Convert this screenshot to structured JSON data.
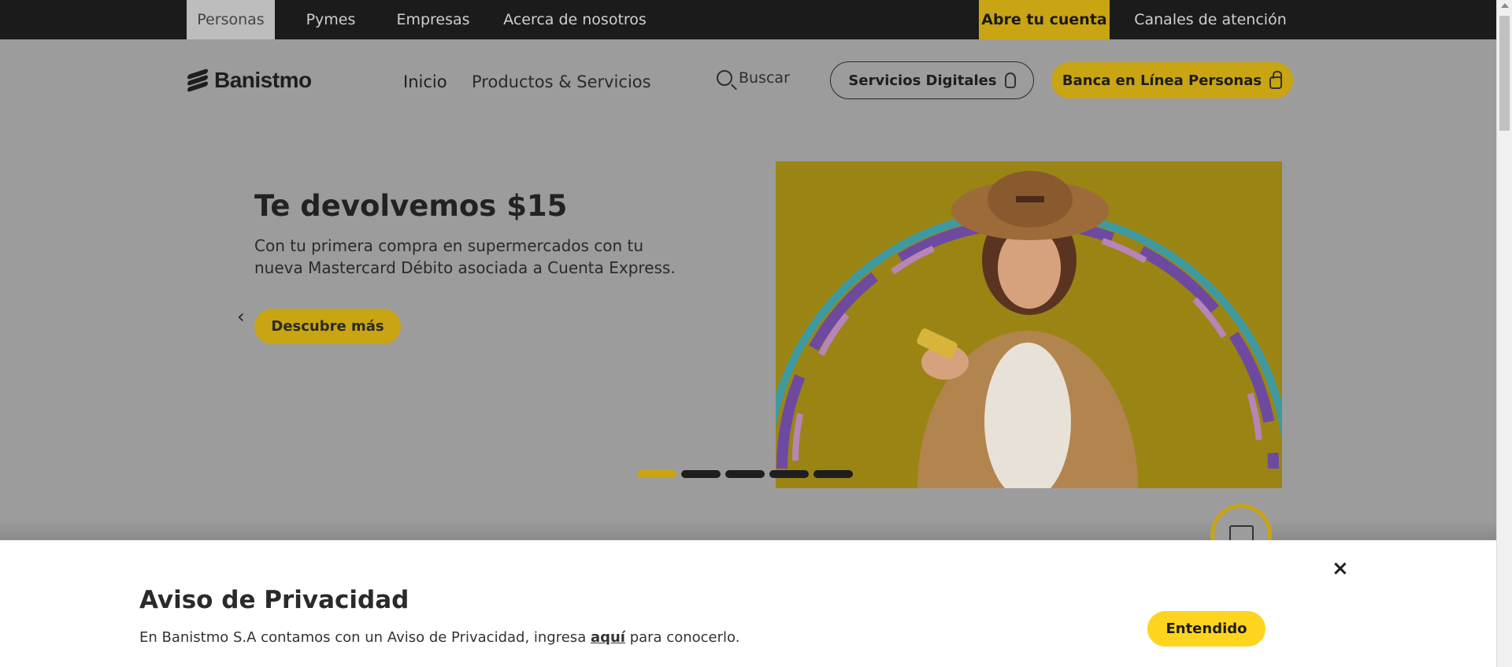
{
  "topbar": {
    "items": [
      {
        "label": "Personas"
      },
      {
        "label": "Pymes"
      },
      {
        "label": "Empresas"
      },
      {
        "label": "Acerca de nosotros"
      },
      {
        "label": "Abre tu cuenta"
      },
      {
        "label": "Canales de atención"
      }
    ]
  },
  "header": {
    "logo_text": "Banistmo",
    "nav": [
      {
        "label": "Inicio"
      },
      {
        "label": "Productos & Servicios"
      }
    ],
    "search_label": "Buscar",
    "digital_services_label": "Servicios Digitales",
    "online_banking_label": "Banca en Línea Personas"
  },
  "hero": {
    "title": "Te devolvemos $15",
    "description": "Con tu primera compra en supermercados con tu nueva Mastercard Débito asociada a Cuenta Express.",
    "cta_label": "Descubre más",
    "prev_arrow": "‹",
    "next_arrow": "›",
    "slide_count": 5,
    "active_slide": 1
  },
  "privacy": {
    "title": "Aviso de Privacidad",
    "text_before": "En Banistmo S.A contamos con un Aviso de Privacidad, ingresa ",
    "link_text": "aquí",
    "text_after": " para conocerlo.",
    "close_symbol": "×",
    "accept_label": "Entendido"
  },
  "colors": {
    "brand_yellow": "#ffd41f",
    "overlay_yellow": "#c9a413",
    "topbar_bg": "#1b1b1b",
    "dark_text": "#1e1e1e"
  }
}
